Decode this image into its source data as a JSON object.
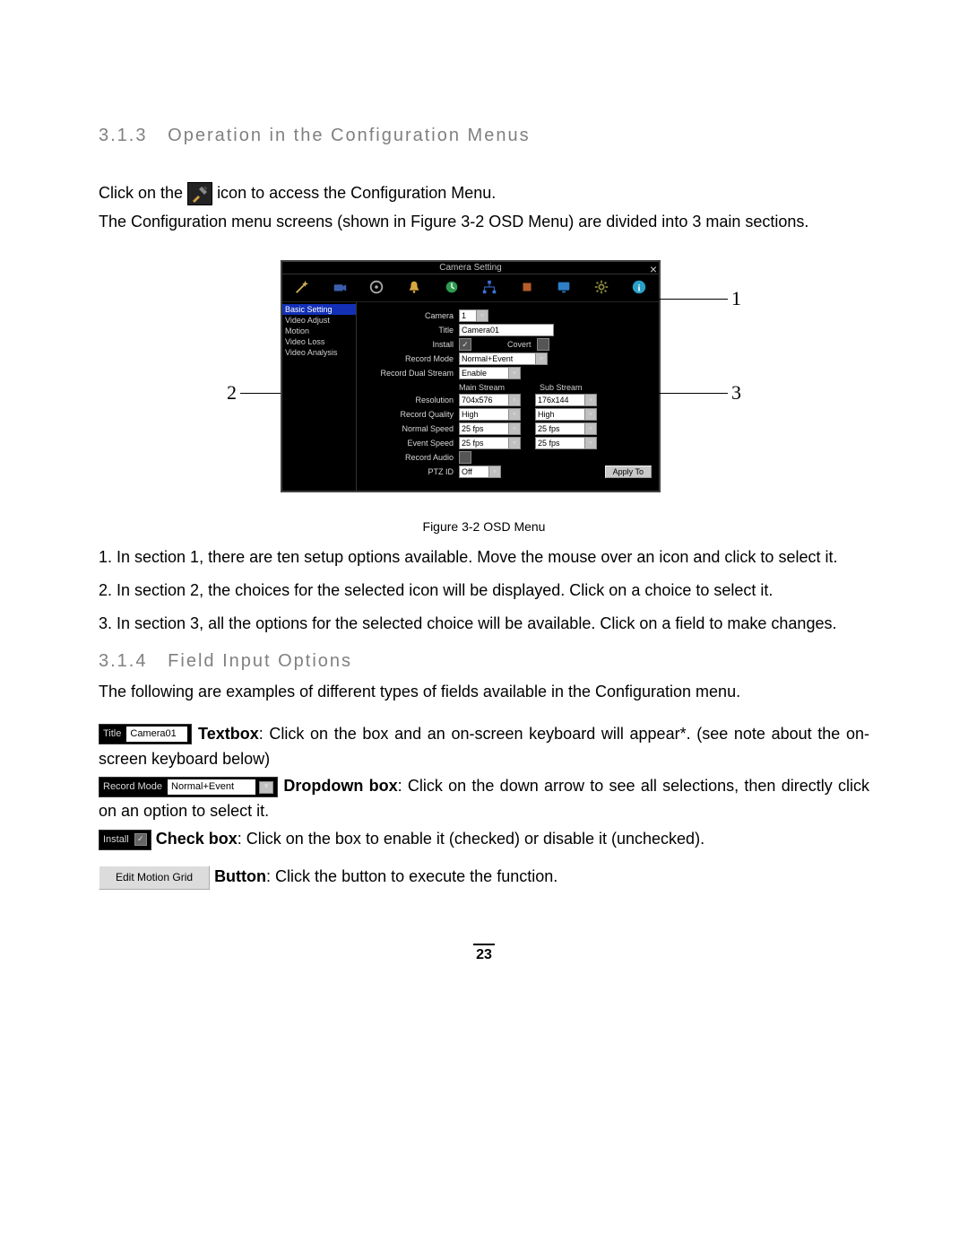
{
  "heading313_num": "3.1.3",
  "heading313_txt": "Operation in the Configuration Menus",
  "para1_a": "Click on the ",
  "para1_b": " icon to access the Configuration Menu.",
  "para2": "The Configuration menu screens (shown in Figure 3-2 OSD Menu) are divided into 3 main sections.",
  "leader1": "1",
  "leader2": "2",
  "leader3": "3",
  "osd": {
    "title": "Camera Setting",
    "sidebar": [
      "Basic Setting",
      "Video Adjust",
      "Motion",
      "Video Loss",
      "Video Analysis"
    ],
    "rows": {
      "camera_lbl": "Camera",
      "camera_val": "1",
      "title_lbl": "Title",
      "title_val": "Camera01",
      "install_lbl": "Install",
      "covert_lbl": "Covert",
      "recmode_lbl": "Record Mode",
      "recmode_val": "Normal+Event",
      "dual_lbl": "Record Dual Stream",
      "dual_val": "Enable",
      "mainstream": "Main Stream",
      "substream": "Sub Stream",
      "res_lbl": "Resolution",
      "res_main": "704x576",
      "res_sub": "176x144",
      "q_lbl": "Record Quality",
      "q_main": "High",
      "q_sub": "High",
      "ns_lbl": "Normal Speed",
      "ns_main": "25 fps",
      "ns_sub": "25 fps",
      "es_lbl": "Event Speed",
      "es_main": "25 fps",
      "es_sub": "25 fps",
      "ra_lbl": "Record Audio",
      "ptz_lbl": "PTZ ID",
      "ptz_val": "Off",
      "apply": "Apply To"
    }
  },
  "fig_caption": "Figure 3-2 OSD Menu",
  "list1": "1. In section 1, there are ten setup options available. Move the mouse over an icon and click to select it.",
  "list2": "2. In section 2, the choices for the selected icon will be displayed. Click on a choice to select it.",
  "list3": "3. In section 3, all the options for the selected choice will be available. Click on a field to make changes.",
  "heading314_num": "3.1.4",
  "heading314_txt": "Field Input Options",
  "para314": "The following are examples of different types of fields available in the Configuration menu.",
  "ex_textbox": {
    "field_lbl": "Title",
    "field_val": "Camera01",
    "bold": "Textbox",
    "rest": ": Click on the box and an on-screen keyboard will appear*. (see note about the on-screen keyboard below)"
  },
  "ex_dropdown": {
    "field_lbl": "Record Mode",
    "field_val": "Normal+Event",
    "bold": "Dropdown box",
    "rest": ": Click on the down arrow to see all selections, then directly click on an option to select it."
  },
  "ex_checkbox": {
    "field_lbl": "Install",
    "bold": "Check box",
    "rest": ": Click on the box to enable it (checked) or disable it (unchecked)."
  },
  "ex_button": {
    "field_val": "Edit Motion Grid",
    "bold": "Button",
    "rest": ": Click the button to execute the function."
  },
  "page_num": "23"
}
